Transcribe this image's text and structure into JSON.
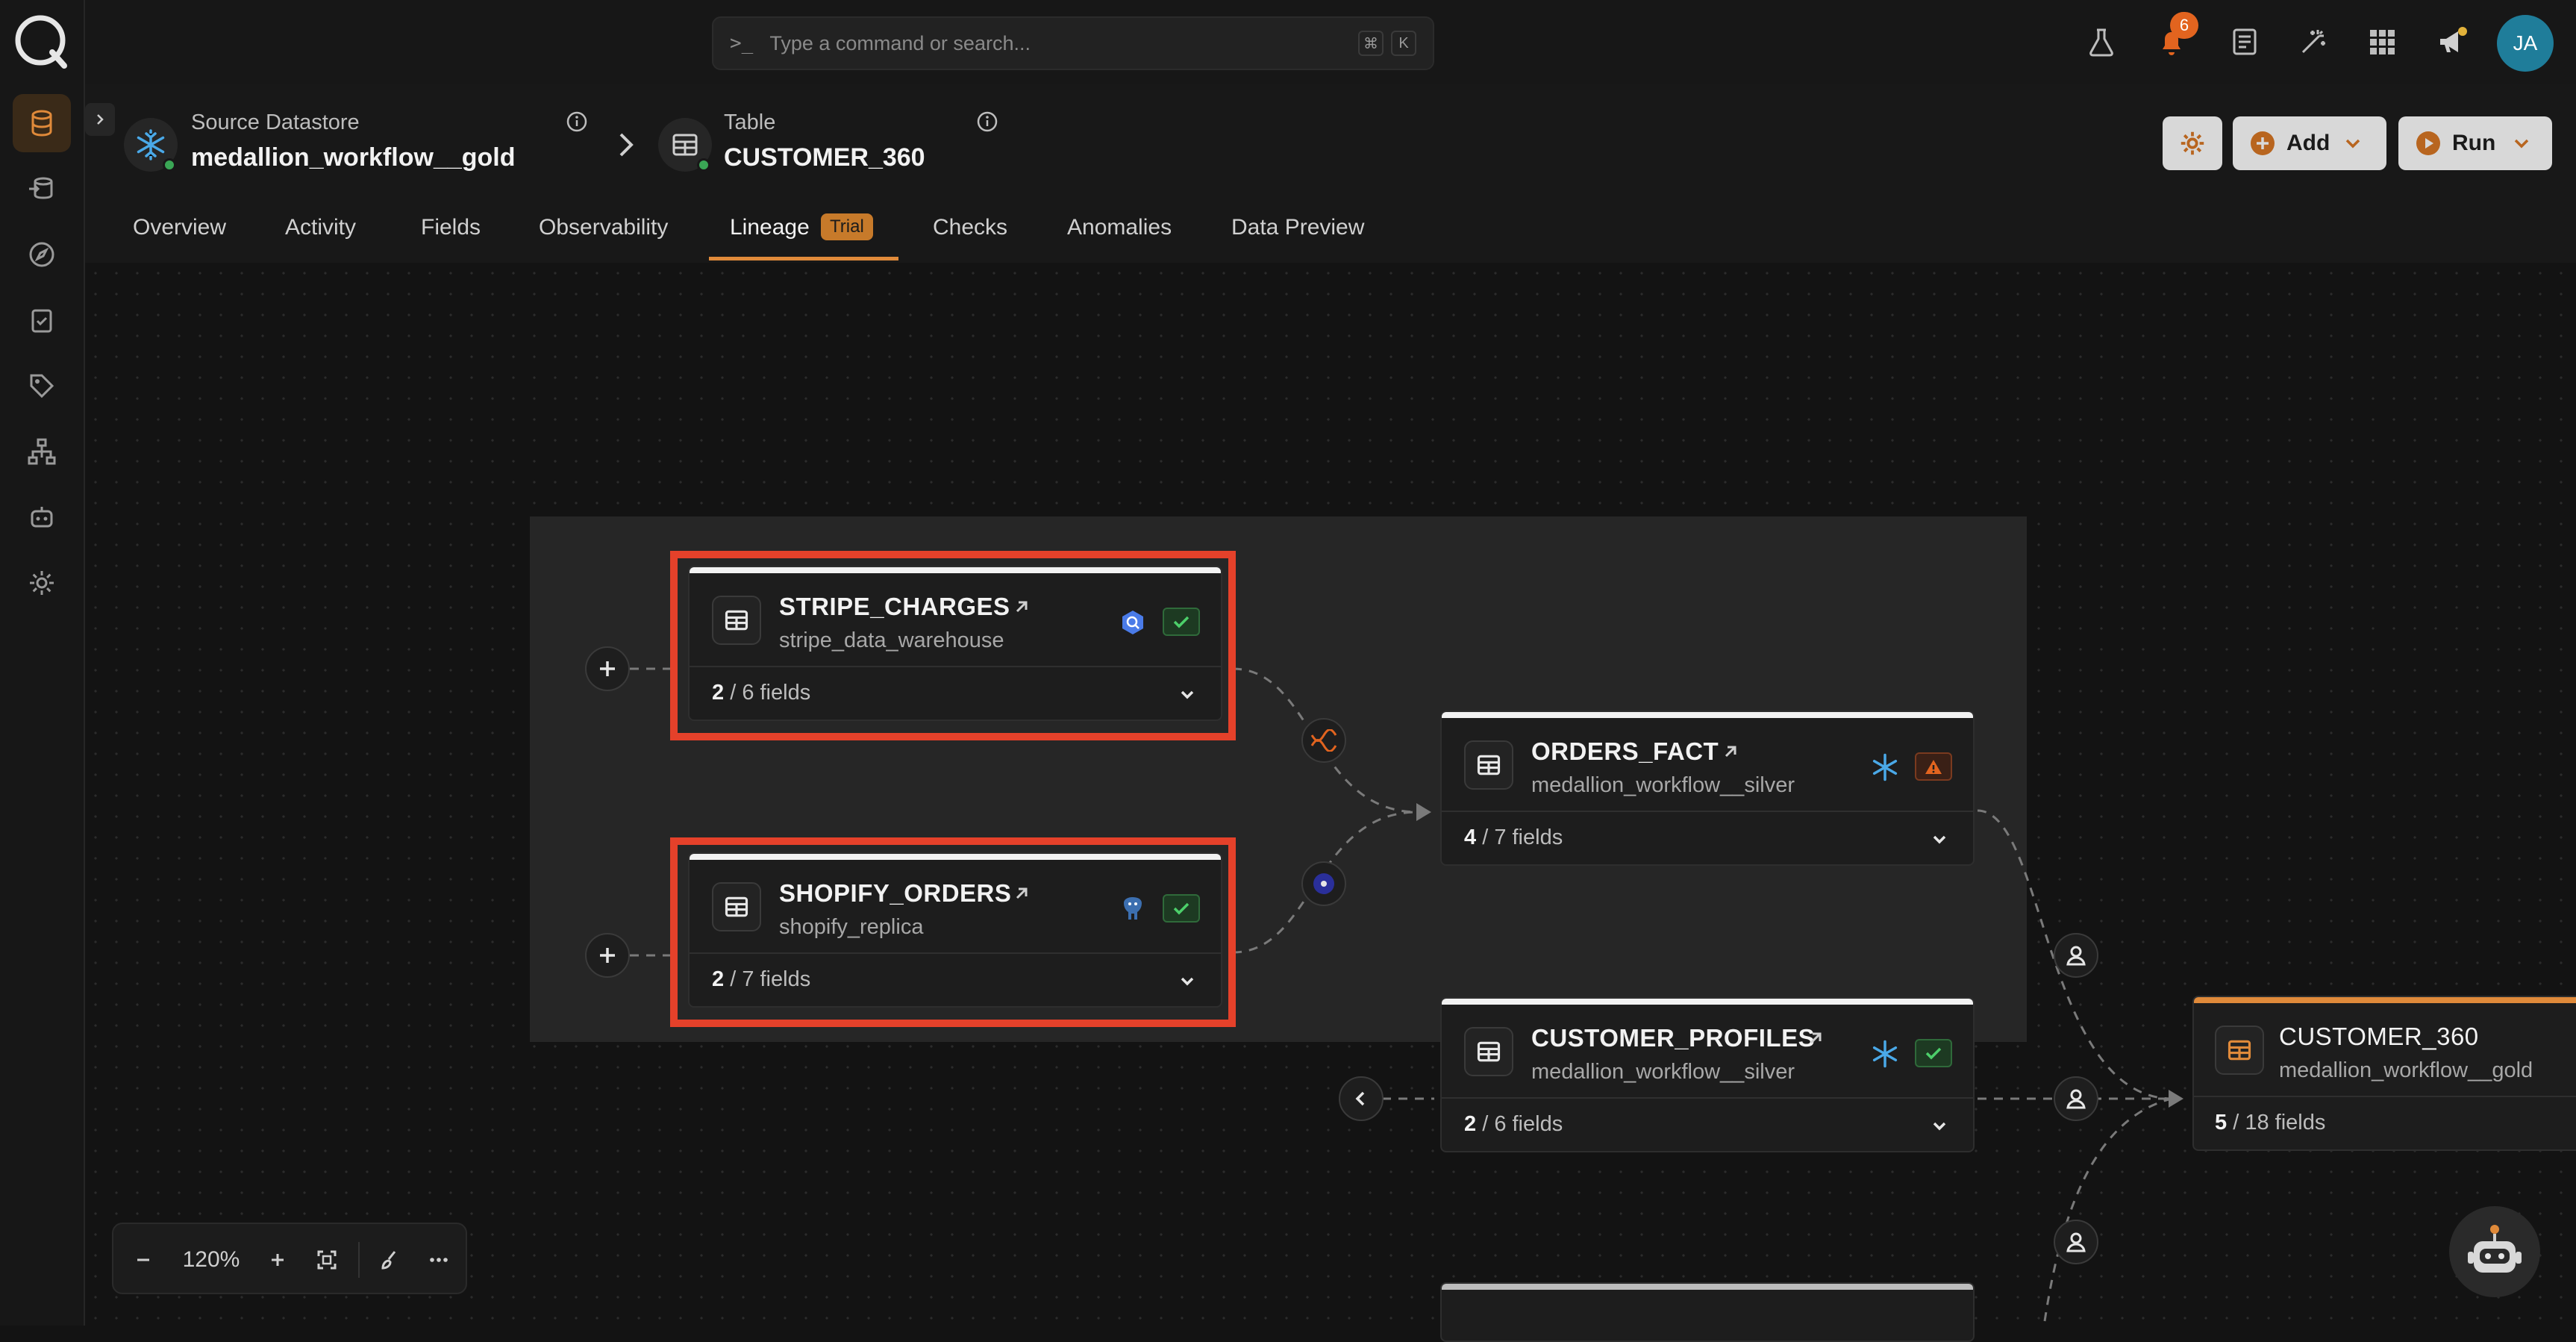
{
  "command_bar": {
    "placeholder": "Type a command or search...",
    "shortcut_mod": "⌘",
    "shortcut_key": "K"
  },
  "notifications": {
    "count": "6"
  },
  "user": {
    "initials": "JA"
  },
  "breadcrumb": {
    "datastore_label": "Source Datastore",
    "datastore_name": "medallion_workflow__gold",
    "table_label": "Table",
    "table_name": "CUSTOMER_360"
  },
  "actions": {
    "add_label": "Add",
    "run_label": "Run"
  },
  "tabs": [
    {
      "label": "Overview"
    },
    {
      "label": "Activity"
    },
    {
      "label": "Fields"
    },
    {
      "label": "Observability"
    },
    {
      "label": "Lineage",
      "badge": "Trial",
      "active": true
    },
    {
      "label": "Checks"
    },
    {
      "label": "Anomalies"
    },
    {
      "label": "Data Preview"
    }
  ],
  "nodes": {
    "stripe": {
      "title": "STRIPE_CHARGES",
      "subtitle": "stripe_data_warehouse",
      "fields_selected": "2",
      "fields_total": "/ 6 fields",
      "status": "ok"
    },
    "shopify": {
      "title": "SHOPIFY_ORDERS",
      "subtitle": "shopify_replica",
      "fields_selected": "2",
      "fields_total": "/ 7 fields",
      "status": "ok"
    },
    "orders": {
      "title": "ORDERS_FACT",
      "subtitle": "medallion_workflow__silver",
      "fields_selected": "4",
      "fields_total": "/ 7 fields",
      "status": "warning"
    },
    "profiles": {
      "title": "CUSTOMER_PROFILES",
      "subtitle": "medallion_workflow__silver",
      "fields_selected": "2",
      "fields_total": "/ 6 fields",
      "status": "ok"
    },
    "customer360": {
      "title": "CUSTOMER_360",
      "subtitle": "medallion_workflow__gold",
      "fields_selected": "5",
      "fields_total": "/ 18 fields"
    }
  },
  "zoom": {
    "level": "120%"
  },
  "colors": {
    "accent": "#e08a3a",
    "highlight": "#e5412a",
    "success": "#3aa655",
    "warning": "#e2641f",
    "snowflake": "#4aa9e8"
  }
}
